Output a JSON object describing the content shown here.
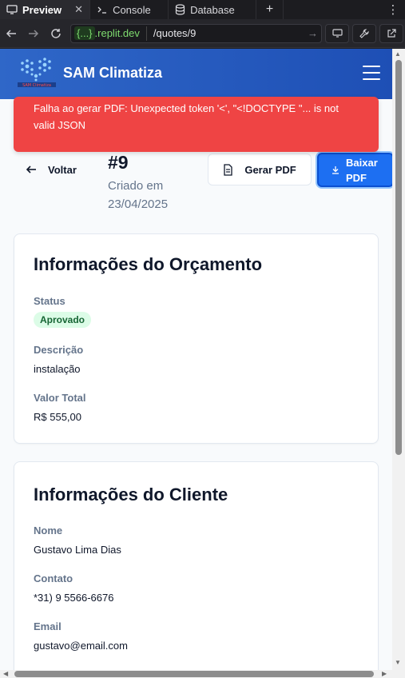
{
  "browser": {
    "tabs": [
      {
        "label": "Preview",
        "close": "✕"
      },
      {
        "label": "Console"
      },
      {
        "label": "Database"
      }
    ],
    "add_tab": "+",
    "more": "⋮",
    "url_host": "{...}",
    "url_host_rest": ".replit.dev",
    "url_path": "/quotes/9"
  },
  "app": {
    "brand": "SAM Climatiza",
    "logo_text": "SAM Climatiza"
  },
  "toast": {
    "message": "Falha ao gerar PDF: Unexpected token '<', \"<!DOCTYPE \"... is not valid JSON"
  },
  "quote": {
    "back_label": "Voltar",
    "number": "#9",
    "created_label": "Criado em 23/04/2025",
    "gerar_pdf_label": "Gerar PDF",
    "baixar_pdf_label": "Baixar PDF"
  },
  "quote_info": {
    "title": "Informações do Orçamento",
    "status_label": "Status",
    "status_value": "Aprovado",
    "description_label": "Descrição",
    "description_value": "instalação",
    "total_label": "Valor Total",
    "total_value": "R$ 555,00"
  },
  "client_info": {
    "title": "Informações do Cliente",
    "name_label": "Nome",
    "name_value": "Gustavo Lima Dias",
    "contact_label": "Contato",
    "contact_value": "*31) 9 5566-6676",
    "email_label": "Email",
    "email_value": "gustavo@email.com"
  },
  "colors": {
    "header": "#2f67c8",
    "toast": "#ef4444",
    "primary_button": "#1d6ff2",
    "badge_bg": "#dcfce7",
    "badge_text": "#166534"
  }
}
